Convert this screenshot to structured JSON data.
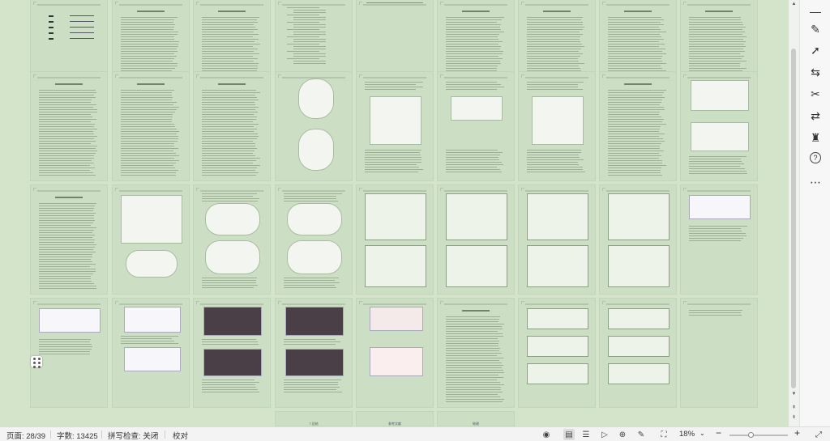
{
  "document": {
    "bottom_tabs": [
      "7 总结",
      "参考文献",
      "致谢"
    ]
  },
  "right_toolbar": {
    "tools": [
      {
        "name": "minimize-icon",
        "glyph": "—"
      },
      {
        "name": "pen-icon",
        "glyph": "✎"
      },
      {
        "name": "cursor-icon",
        "glyph": "➚"
      },
      {
        "name": "adjust-icon",
        "glyph": "⇆"
      },
      {
        "name": "tools-icon",
        "glyph": "✂"
      },
      {
        "name": "translate-icon",
        "glyph": "⇄"
      },
      {
        "name": "shirt-icon",
        "glyph": "♜"
      },
      {
        "name": "help-icon",
        "glyph": "?"
      },
      {
        "name": "more-icon",
        "glyph": "⋯"
      }
    ]
  },
  "statusbar": {
    "page": "页面: 28/39",
    "word_count": "字数: 13425",
    "spellcheck": "拼写检查: 关闭",
    "spellcheck_caret": "⌄",
    "proofread": "校对",
    "zoom": "18%",
    "zoom_level": 0.18,
    "zoom_caret": "⌄",
    "zoom_minus": "−",
    "zoom_plus": "+"
  },
  "colors": {
    "canvas": "#d3e4cb",
    "page": "#ccdfc4",
    "statusbar": "#f3f3f3"
  }
}
